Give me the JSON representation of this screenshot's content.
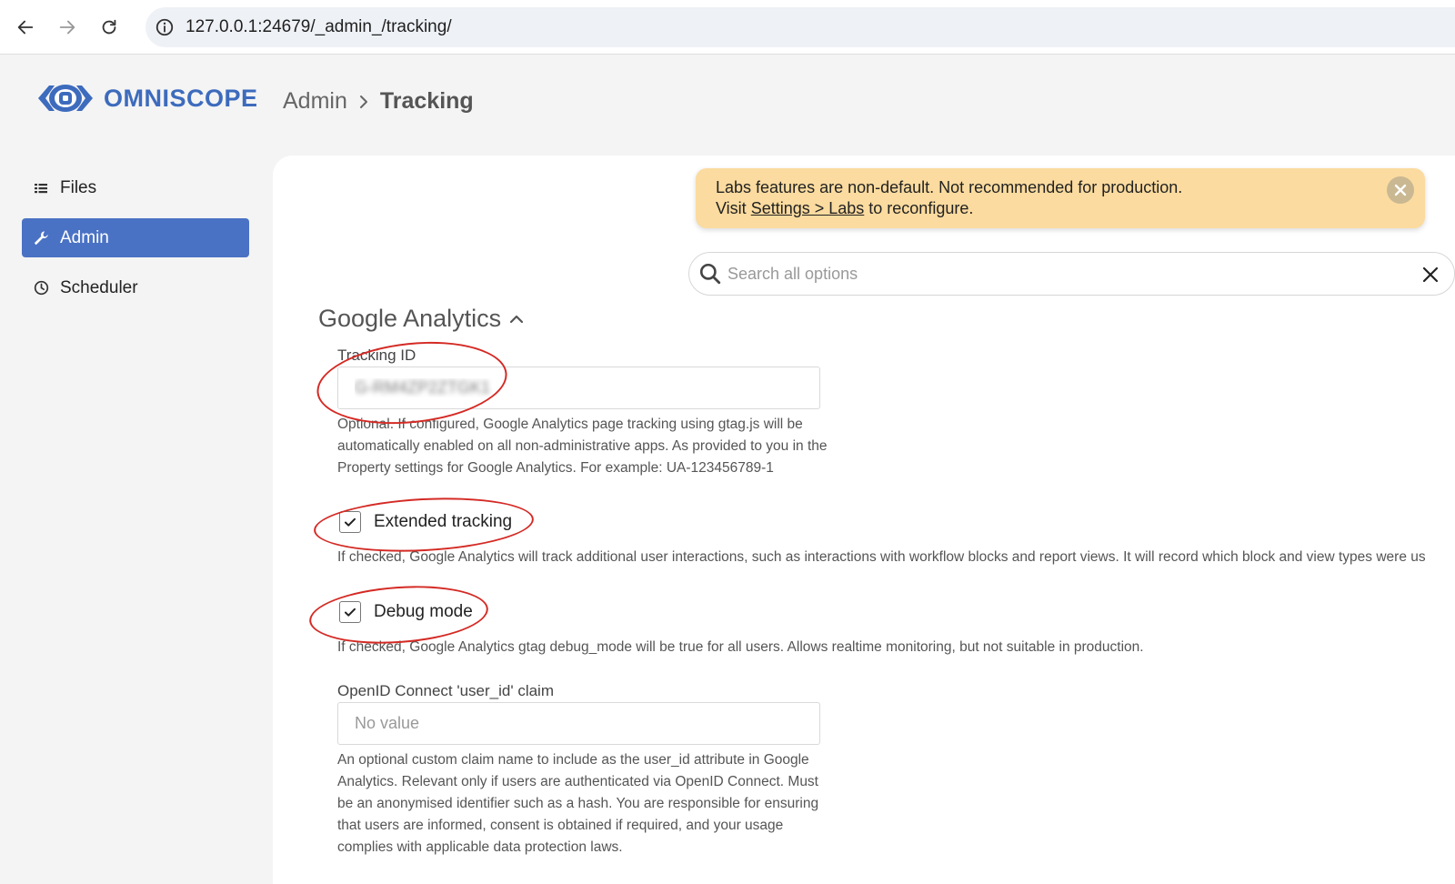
{
  "browser": {
    "url": "127.0.0.1:24679/_admin_/tracking/"
  },
  "app": {
    "logo_text": "OMNISCOPE",
    "brand_color": "#3d6bbd"
  },
  "breadcrumb": {
    "parent": "Admin",
    "current": "Tracking"
  },
  "sidebar": {
    "items": [
      {
        "label": "Files",
        "icon": "list-icon",
        "active": false
      },
      {
        "label": "Admin",
        "icon": "wrench-icon",
        "active": true
      },
      {
        "label": "Scheduler",
        "icon": "clock-icon",
        "active": false
      }
    ]
  },
  "banner": {
    "line1": "Labs features are non-default. Not recommended for production.",
    "line2_prefix": "Visit ",
    "line2_link": "Settings > Labs",
    "line2_suffix": " to reconfigure."
  },
  "search": {
    "placeholder": "Search all options"
  },
  "section": {
    "title": "Google Analytics"
  },
  "fields": {
    "tracking_id": {
      "label": "Tracking ID",
      "value": "G-RM4ZP2ZTGK1",
      "help": "Optional. If configured, Google Analytics page tracking using gtag.js will be automatically enabled on all non-administrative apps. As provided to you in the Property settings for Google Analytics. For example: UA-123456789-1"
    },
    "extended_tracking": {
      "label": "Extended tracking",
      "checked": true,
      "help": "If checked, Google Analytics will track additional user interactions, such as interactions with workflow blocks and report views. It will record which block and view types were us"
    },
    "debug_mode": {
      "label": "Debug mode",
      "checked": true,
      "help": "If checked, Google Analytics gtag debug_mode will be true for all users. Allows realtime monitoring, but not suitable in production."
    },
    "openid_claim": {
      "label": "OpenID Connect 'user_id' claim",
      "placeholder": "No value",
      "help": "An optional custom claim name to include as the user_id attribute in Google Analytics. Relevant only if users are authenticated via OpenID Connect. Must be an anonymised identifier such as a hash. You are responsible for ensuring that users are informed, consent is obtained if required, and your usage complies with applicable data protection laws."
    }
  }
}
